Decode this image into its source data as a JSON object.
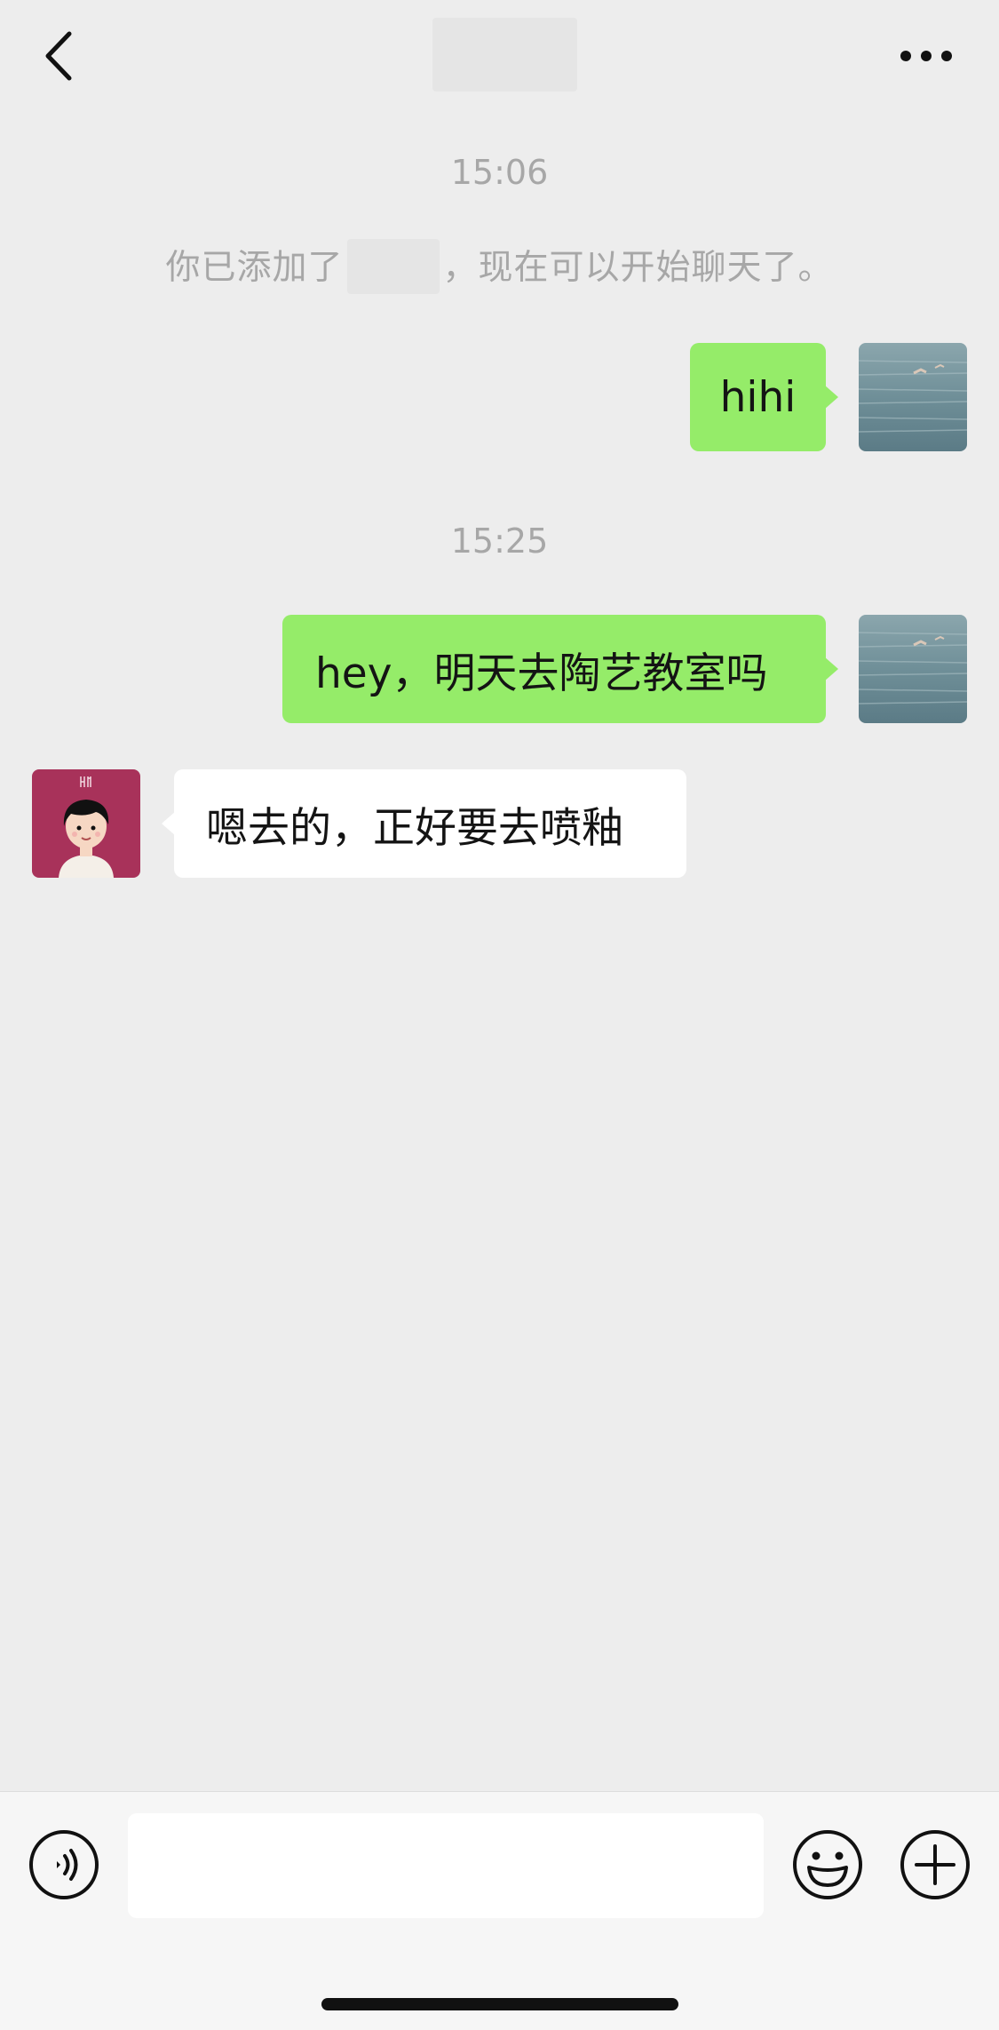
{
  "header": {
    "back_icon": "chevron-left-icon",
    "more_icon": "more-dots-icon"
  },
  "messages": {
    "time_1": "15:06",
    "system_text_before": "你已添加了",
    "system_text_after": "，现在可以开始聊天了。",
    "sent_1": "hihi",
    "time_2": "15:25",
    "sent_2": "hey，明天去陶艺教室吗",
    "received_1": "嗯去的，正好要去喷釉"
  },
  "input_bar": {
    "voice_icon": "voice-icon",
    "emoji_icon": "emoji-icon",
    "plus_icon": "plus-icon",
    "message_value": ""
  },
  "colors": {
    "background": "#ededed",
    "sent_bubble": "#95ec69",
    "received_bubble": "#ffffff",
    "muted_text": "#a7a7a7",
    "avatar_bg": "#a8325a"
  }
}
